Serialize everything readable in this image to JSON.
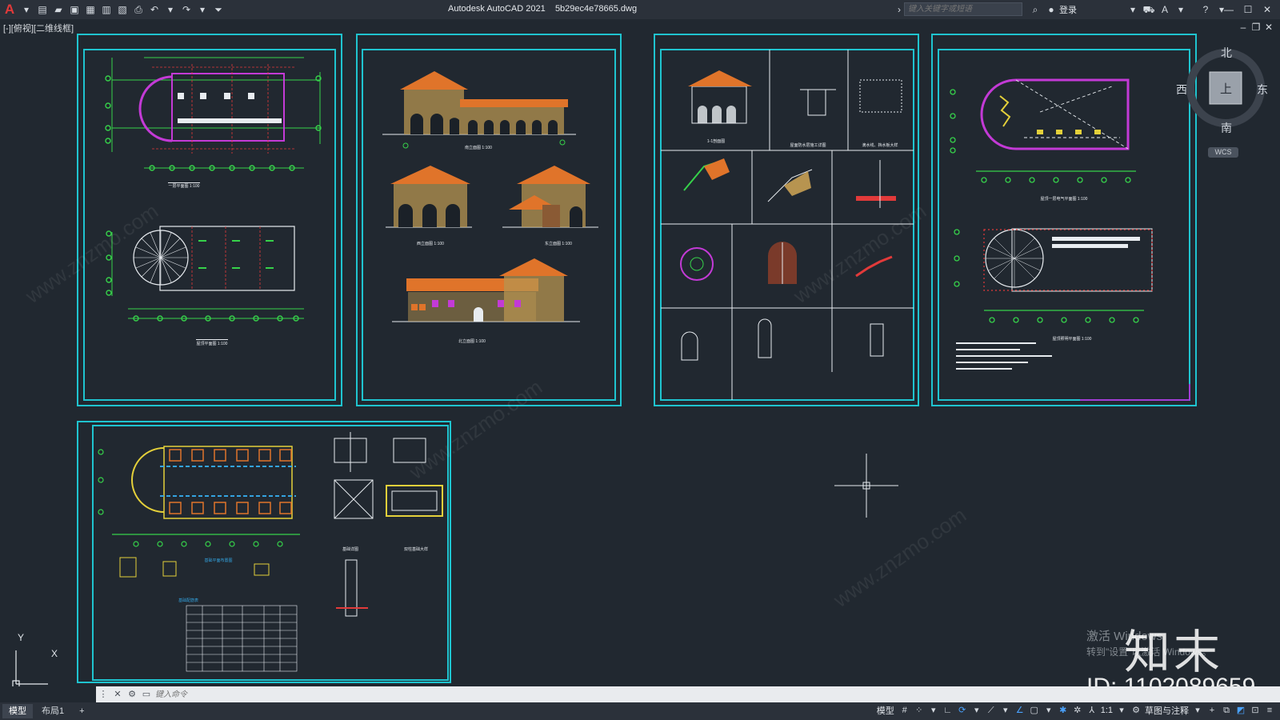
{
  "titlebar": {
    "app_name": "Autodesk AutoCAD 2021",
    "file_name": "5b29ec4e78665.dwg",
    "search_placeholder": "键入关键字或短语",
    "login_label": "登录"
  },
  "viewport": {
    "label": "[-][俯视][二维线框]"
  },
  "viewcube": {
    "north": "北",
    "south": "南",
    "east": "东",
    "west": "西",
    "face": "上",
    "wcs": "WCS"
  },
  "ucs": {
    "x": "X",
    "y": "Y"
  },
  "command": {
    "placeholder": "键入命令"
  },
  "status": {
    "tabs": [
      "模型",
      "布局1"
    ],
    "add_tab": "+",
    "model_label": "模型",
    "scale": "1:1",
    "workspace": "草图与注释"
  },
  "watermark": {
    "brand": "知末",
    "id_text": "ID: 1102089659",
    "activate_line1": "激活 Windows",
    "activate_line2": "转到\"设置\"以激活 Windows。",
    "site": "www.znzmo.com"
  },
  "drawing_labels": {
    "s1_plan1": "一层平面图 1:100",
    "s1_plan2": "屋顶平面图 1:100",
    "s2_elev1": "南立面图 1:100",
    "s2_elev2": "西立面图 1:100",
    "s2_elev3": "东立面图 1:100",
    "s2_elev4": "北立面图 1:100",
    "s3_sec": "1-1剖面图",
    "s3_d1": "屋面防水层施工详图",
    "s3_d2": "滴水线、挡水板大样",
    "s4_plan1": "屋顶一层电气平面图 1:100",
    "s4_plan2": "屋顶照明平面图 1:100",
    "s5_d1": "基础平面布置图",
    "s5_d2": "基础详图",
    "s5_d3": "双柱基础大样",
    "s5_table": "基础配筋表"
  },
  "colors": {
    "background": "#212830",
    "sheet_border": "#1fc4cf",
    "roof_orange": "#e0742a",
    "wall_yellow": "#d8b25a",
    "line_green": "#36d24a",
    "purple": "#c33ad6",
    "red": "#e23a3a",
    "white": "#e8ecf0"
  }
}
